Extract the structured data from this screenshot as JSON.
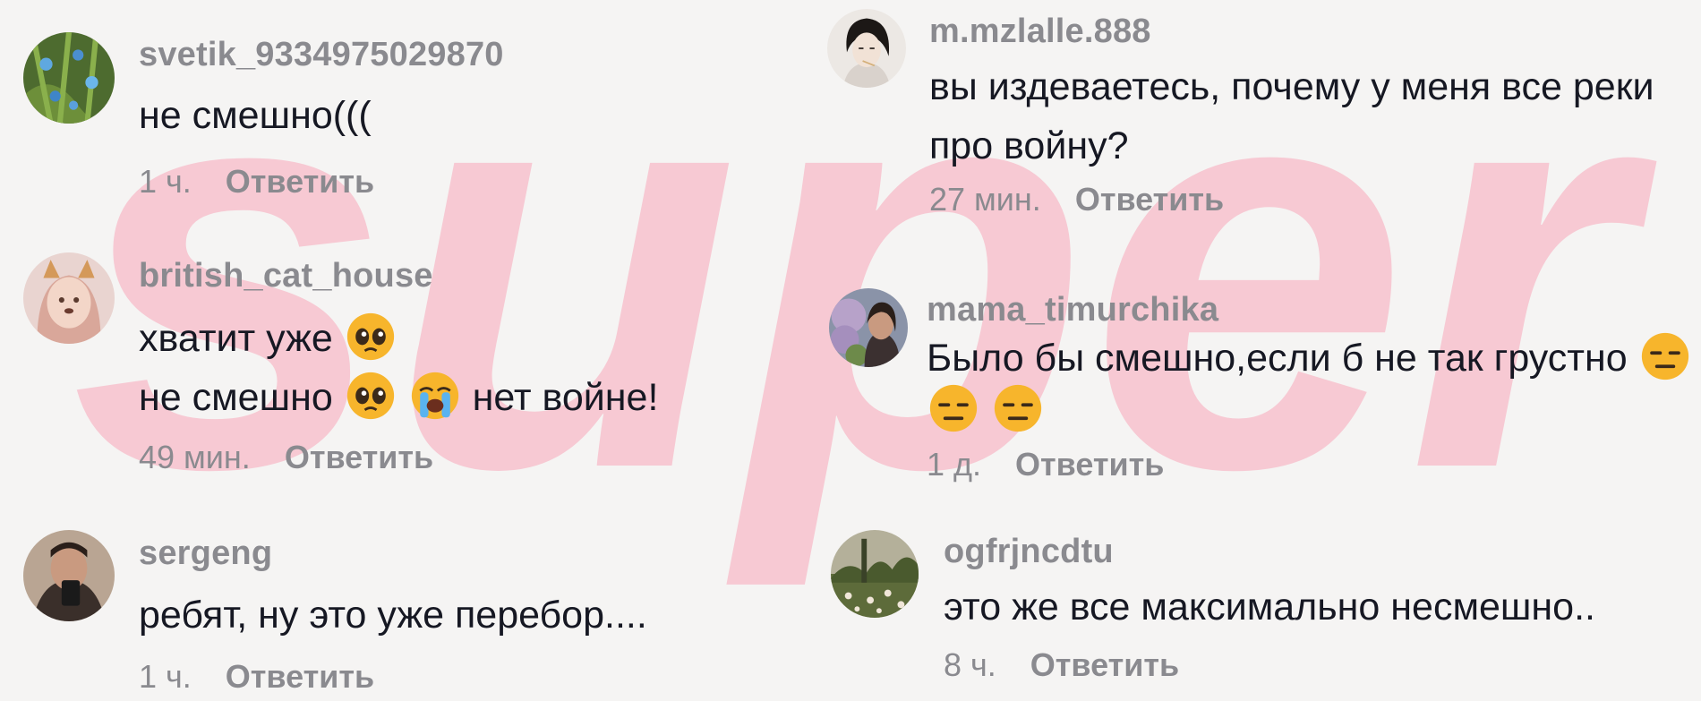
{
  "watermark": {
    "text": "super",
    "color": "#f7a6b8"
  },
  "reply_label": "Ответить",
  "comments": [
    {
      "username": "svetik_9334975029870",
      "lines": [
        "не смешно((("
      ],
      "time": "1 ч.",
      "avatar": "flowers-photo-avatar"
    },
    {
      "username": "british_cat_house",
      "lines": [
        "хватит уже",
        "не смешно",
        "нет войне!"
      ],
      "time": "49 мин.",
      "avatar": "girl-filter-avatar"
    },
    {
      "username": "sergeng",
      "lines": [
        "ребят, ну это уже перебор...."
      ],
      "time": "1 ч.",
      "avatar": "man-phone-avatar"
    },
    {
      "username": "m.mzlalle.888",
      "lines": [
        "вы издеваетесь, почему у меня все реки",
        "про войну?"
      ],
      "time": "27 мин.",
      "avatar": "anime-art-avatar"
    },
    {
      "username": "mama_timurchika",
      "lines": [
        "Было бы смешно,если б не так грустно"
      ],
      "time": "1 д.",
      "avatar": "woman-lilac-avatar"
    },
    {
      "username": "ogfrjncdtu",
      "lines": [
        "это же все максимально несмешно.."
      ],
      "time": "8 ч.",
      "avatar": "field-photo-avatar"
    }
  ],
  "emoji": {
    "pleading": "pleading-face-emoji",
    "crying": "loudly-crying-face-emoji",
    "neutral": "expressionless-face-emoji"
  },
  "colors": {
    "username": "#8a8a8f",
    "text": "#161823",
    "background": "#f5f4f3"
  }
}
